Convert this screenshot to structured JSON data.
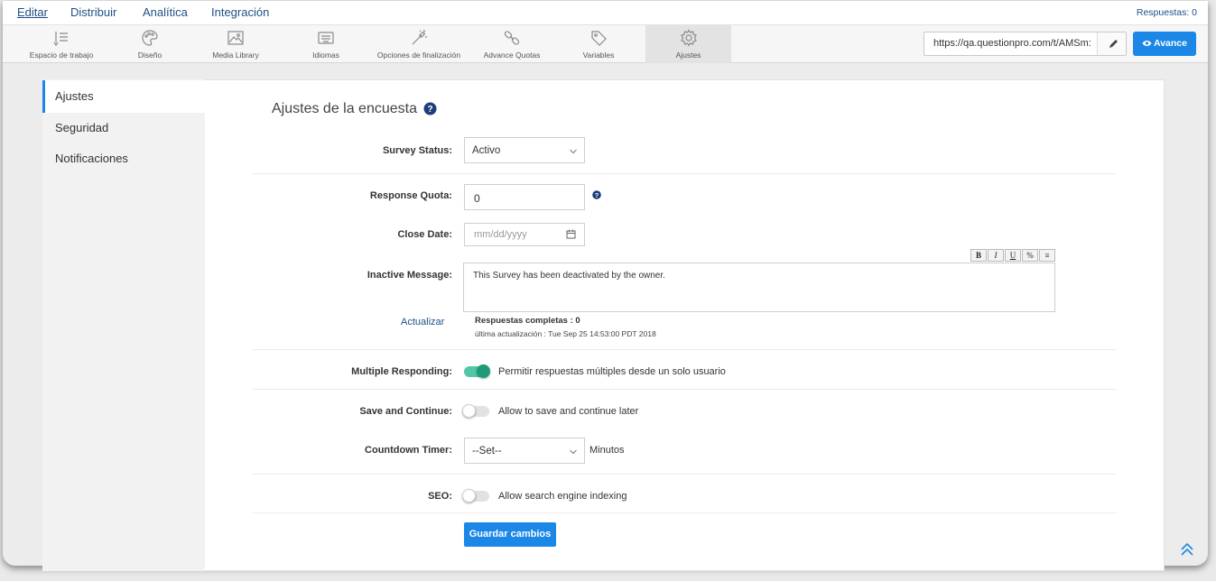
{
  "menu": {
    "items": [
      "Editar",
      "Distribuir",
      "Analítica",
      "Integración"
    ],
    "responses": "Respuestas: 0"
  },
  "toolbar": {
    "tools": [
      {
        "label": "Espacio de trabajo",
        "icon": "workspace-icon"
      },
      {
        "label": "Diseño",
        "icon": "palette-icon"
      },
      {
        "label": "Media Library",
        "icon": "image-icon"
      },
      {
        "label": "Idiomas",
        "icon": "keyboard-icon"
      },
      {
        "label": "Opciones de finalización",
        "icon": "magic-wand-icon"
      },
      {
        "label": "Advance Quotas",
        "icon": "link-chain-icon"
      },
      {
        "label": "Variables",
        "icon": "tag-icon"
      },
      {
        "label": "Ajustes",
        "icon": "gear-icon"
      }
    ],
    "active_tool": "Ajustes",
    "url": "https://qa.questionpro.com/t/AMSm:",
    "preview_label": "Avance"
  },
  "sidenav": {
    "items": [
      "Ajustes",
      "Seguridad",
      "Notificaciones"
    ],
    "active": "Ajustes"
  },
  "page": {
    "title": "Ajustes de la encuesta"
  },
  "form": {
    "survey_status": {
      "label": "Survey Status:",
      "value": "Activo"
    },
    "response_quota": {
      "label": "Response Quota:",
      "value": "0"
    },
    "close_date": {
      "label": "Close Date:",
      "placeholder": "mm/dd/yyyy"
    },
    "inactive_message": {
      "label": "Inactive Message:",
      "value": "This Survey has been deactivated by the owner.",
      "toolbar": [
        "B",
        "I",
        "U",
        "%",
        "≡"
      ]
    },
    "update_link": "Actualizar",
    "complete_responses": "Respuestas completas : 0",
    "last_update": "última actualización : Tue Sep 25 14:53:00 PDT 2018",
    "multiple_responding": {
      "label": "Multiple Responding:",
      "on": true,
      "text": "Permitir respuestas múltiples desde un solo usuario"
    },
    "save_continue": {
      "label": "Save and Continue:",
      "on": false,
      "text": "Allow to save and continue later"
    },
    "countdown_timer": {
      "label": "Countdown Timer:",
      "value": "--Set--",
      "unit": "Minutos"
    },
    "seo": {
      "label": "SEO:",
      "on": false,
      "text": "Allow search engine indexing"
    },
    "save_label": "Guardar cambios"
  },
  "colors": {
    "accent": "#1b87e6",
    "toggle_on": "#1f9a77",
    "link": "#1f4f87"
  }
}
